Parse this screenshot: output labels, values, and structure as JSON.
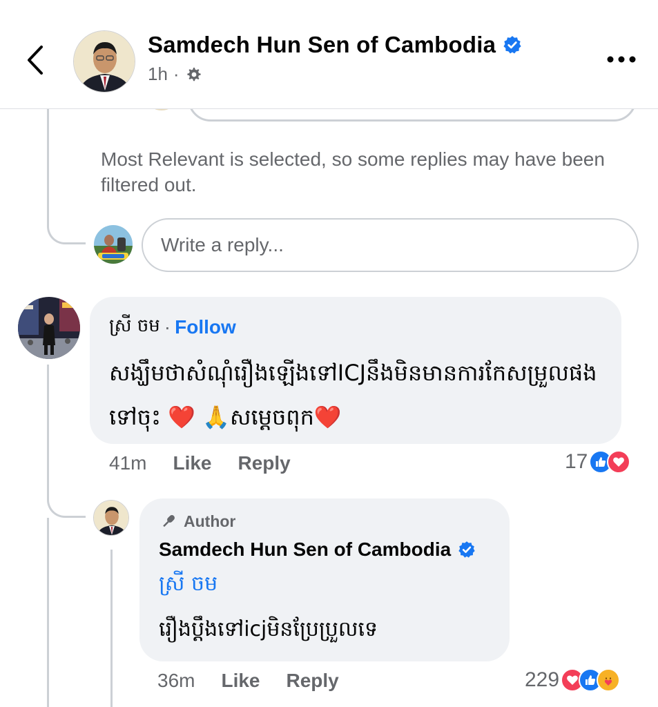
{
  "header": {
    "page_name": "Samdech Hun Sen of Cambodia",
    "time": "1h",
    "separator": "·"
  },
  "notice": {
    "filter_text": "Most Relevant is selected, so some replies may have been filtered out."
  },
  "reply_box": {
    "placeholder": "Write a reply..."
  },
  "comment": {
    "author": "ស្រី ចម",
    "separator": "·",
    "follow_label": "Follow",
    "text": "សង្ឃឹមថាសំណុំរឿងឡើងទៅICJនឹងមិនមានការកែសម្រួលផងទៅចុះ ❤️ 🙏សម្ដេចពុក❤️",
    "time": "41m",
    "like_label": "Like",
    "reply_label": "Reply",
    "reaction_count": "17",
    "reaction_icons": [
      "like-icon",
      "love-icon"
    ]
  },
  "author_reply": {
    "badge_label": "Author",
    "author": "Samdech Hun Sen of Cambodia",
    "mention": "ស្រី ចម",
    "text": "រឿងប្ដឹងទៅicjមិនប្រែប្រួលទេ",
    "time": "36m",
    "like_label": "Like",
    "reply_label": "Reply",
    "reaction_count": "229",
    "reaction_icons": [
      "love-icon",
      "like-icon",
      "care-icon"
    ]
  },
  "colors": {
    "brand_blue": "#1877f2",
    "love_red": "#f33e58",
    "bubble_gray": "#f0f2f5",
    "secondary_text": "#65676b",
    "thread_line": "#ccd0d5"
  }
}
